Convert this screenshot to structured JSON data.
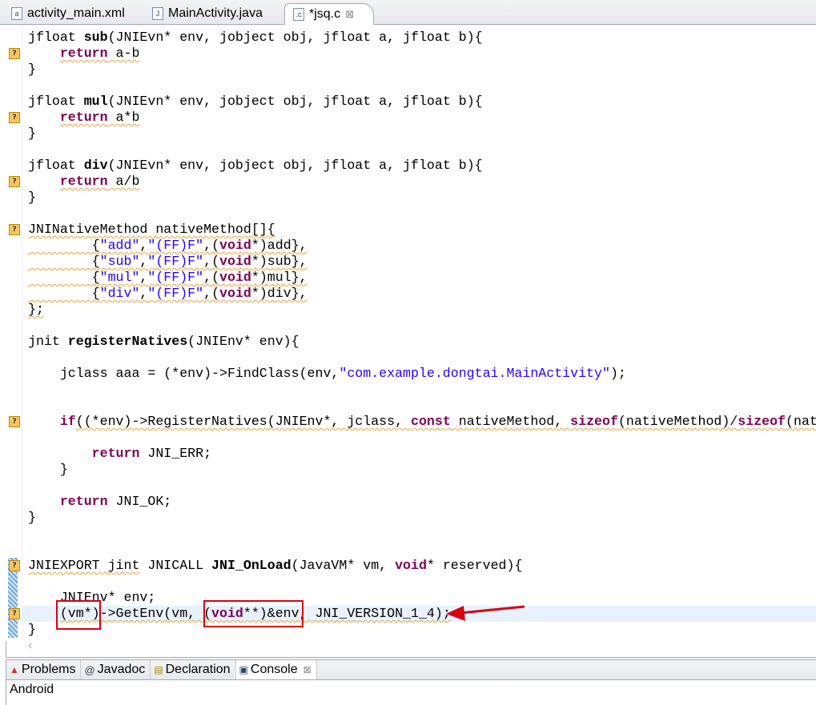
{
  "tabs": [
    {
      "label": "activity_main.xml",
      "icon": "xml-file-icon"
    },
    {
      "label": "MainActivity.java",
      "icon": "java-file-warning-icon"
    },
    {
      "label": "*jsq.c",
      "icon": "c-file-icon",
      "close": "⊠"
    }
  ],
  "code": [
    [
      [
        "jfloat ",
        ""
      ],
      [
        "sub",
        "b"
      ],
      [
        "(JNIEvn* env, jobject obj, jfloat a, jfloat b){",
        ""
      ]
    ],
    [
      [
        "    ",
        ""
      ],
      [
        "return",
        "k w"
      ],
      [
        " a-b",
        "w"
      ]
    ],
    [
      [
        "}",
        ""
      ]
    ],
    [],
    [
      [
        "jfloat ",
        ""
      ],
      [
        "mul",
        "b"
      ],
      [
        "(JNIEvn* env, jobject obj, jfloat a, jfloat b){",
        ""
      ]
    ],
    [
      [
        "    ",
        ""
      ],
      [
        "return",
        "k w"
      ],
      [
        " a*b",
        "w"
      ]
    ],
    [
      [
        "}",
        ""
      ]
    ],
    [],
    [
      [
        "jfloat ",
        ""
      ],
      [
        "div",
        "b"
      ],
      [
        "(JNIEvn* env, jobject obj, jfloat a, jfloat b){",
        ""
      ]
    ],
    [
      [
        "    ",
        ""
      ],
      [
        "return",
        "k w"
      ],
      [
        " a/b",
        "w"
      ]
    ],
    [
      [
        "}",
        ""
      ]
    ],
    [],
    [
      [
        "JNINativeMethod nativeMethod[]{",
        "w"
      ]
    ],
    [
      [
        "        {",
        "w"
      ],
      [
        "\"add\"",
        "s w"
      ],
      [
        ",",
        "w"
      ],
      [
        "\"(FF)F\"",
        "s w"
      ],
      [
        ",(",
        "w"
      ],
      [
        "void",
        "k w"
      ],
      [
        "*)add},",
        "w"
      ]
    ],
    [
      [
        "        {",
        "w"
      ],
      [
        "\"sub\"",
        "s w"
      ],
      [
        ",",
        "w"
      ],
      [
        "\"(FF)F\"",
        "s w"
      ],
      [
        ",(",
        "w"
      ],
      [
        "void",
        "k w"
      ],
      [
        "*)sub},",
        "w"
      ]
    ],
    [
      [
        "        {",
        "w"
      ],
      [
        "\"mul\"",
        "s w"
      ],
      [
        ",",
        "w"
      ],
      [
        "\"(FF)F\"",
        "s w"
      ],
      [
        ",(",
        "w"
      ],
      [
        "void",
        "k w"
      ],
      [
        "*)mul},",
        "w"
      ]
    ],
    [
      [
        "        {",
        "w"
      ],
      [
        "\"div\"",
        "s w"
      ],
      [
        ",",
        "w"
      ],
      [
        "\"(FF)F\"",
        "s w"
      ],
      [
        ",(",
        "w"
      ],
      [
        "void",
        "k w"
      ],
      [
        "*)div},",
        "w"
      ]
    ],
    [
      [
        "};",
        "w"
      ]
    ],
    [],
    [
      [
        "jnit ",
        ""
      ],
      [
        "registerNatives",
        "b"
      ],
      [
        "(JNIEnv* env){",
        ""
      ]
    ],
    [],
    [
      [
        "    jclass aaa = (*env)->FindClass(env,",
        ""
      ],
      [
        "\"com.example.dongtai.MainActivity\"",
        "s"
      ],
      [
        ");",
        ""
      ]
    ],
    [],
    [],
    [
      [
        "    ",
        ""
      ],
      [
        "if",
        "k"
      ],
      [
        "((*env)->RegisterNatives(JNIEnv*, jclass, ",
        "w"
      ],
      [
        "const",
        "k w"
      ],
      [
        " nativeMethod, ",
        "w"
      ],
      [
        "sizeof",
        "k w"
      ],
      [
        "(nativeMethod)/",
        "w"
      ],
      [
        "sizeof",
        "k w"
      ],
      [
        "(nat",
        "w"
      ]
    ],
    [],
    [
      [
        "        ",
        ""
      ],
      [
        "return",
        "k"
      ],
      [
        " JNI_ERR;",
        ""
      ]
    ],
    [
      [
        "    }",
        ""
      ]
    ],
    [],
    [
      [
        "    ",
        ""
      ],
      [
        "return",
        "k"
      ],
      [
        " JNI_OK;",
        ""
      ]
    ],
    [
      [
        "}",
        ""
      ]
    ],
    [],
    [],
    [
      [
        "JNIEXPORT jint",
        "w"
      ],
      [
        " JNICALL ",
        ""
      ],
      [
        "JNI_OnLoad",
        "b"
      ],
      [
        "(JavaVM* vm, ",
        ""
      ],
      [
        "void",
        "k"
      ],
      [
        "* reserved){",
        ""
      ]
    ],
    [],
    [
      [
        "    JNIEnv* env;",
        ""
      ]
    ],
    [
      [
        "    ",
        ""
      ],
      [
        "(vm*)->GetEnv(vm, (",
        "w"
      ],
      [
        "void",
        "k w"
      ],
      [
        "**)&env, JNI_VERSION_1_4);",
        "w"
      ]
    ],
    [
      [
        "}",
        ""
      ]
    ]
  ],
  "highlight_line": 36,
  "marker_lines": [
    1,
    5,
    9,
    12,
    24,
    33,
    36
  ],
  "marker_glyph": "?",
  "scroll_left": "‹",
  "bottom_tabs": [
    {
      "label": "Problems",
      "icon": "problems-icon"
    },
    {
      "label": "Javadoc",
      "icon": "at-icon",
      "glyph": "@"
    },
    {
      "label": "Declaration",
      "icon": "declaration-icon"
    },
    {
      "label": "Console",
      "icon": "console-icon",
      "close": "⊠"
    }
  ],
  "console_text": "Android",
  "annotation_color": "#d8000f"
}
